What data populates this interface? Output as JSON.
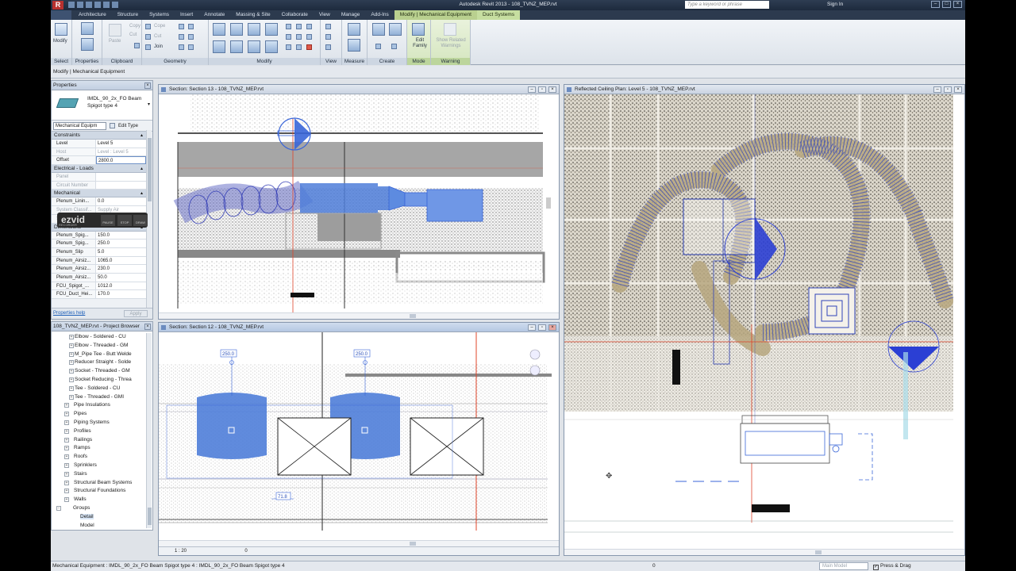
{
  "titlebar": {
    "title": "Autodesk Revit 2013   -   108_TVNZ_MEP.rvt",
    "search_placeholder": "Type a keyword or phrase",
    "sign_in": "Sign In"
  },
  "tabs": [
    {
      "label": "Architecture"
    },
    {
      "label": "Structure"
    },
    {
      "label": "Systems"
    },
    {
      "label": "Insert"
    },
    {
      "label": "Annotate"
    },
    {
      "label": "Massing & Site"
    },
    {
      "label": "Collaborate"
    },
    {
      "label": "View"
    },
    {
      "label": "Manage"
    },
    {
      "label": "Add-Ins"
    },
    {
      "label": "Modify | Mechanical Equipment"
    },
    {
      "label": "Duct Systems"
    }
  ],
  "ribbon": {
    "modify_label": "Modify",
    "paste_label": "Paste",
    "copy_label": "Copy",
    "cut_label": "Cut",
    "join_label": "Join",
    "edit_family_label": "Edit Family",
    "show_warnings_label": "Show Related Warnings",
    "panels": {
      "select": "Select",
      "properties": "Properties",
      "clipboard": "Clipboard",
      "geometry": "Geometry",
      "modify": "Modify",
      "view": "View",
      "measure": "Measure",
      "create": "Create",
      "mode": "Mode",
      "warning": "Warning"
    }
  },
  "options_bar": "Modify | Mechanical Equipment",
  "properties": {
    "title": "Properties",
    "type_name": "IMDL_90_2x_FO Beam Spigot type 4",
    "instance_filter": "Mechanical Equipm",
    "edit_type": "Edit Type",
    "groups": [
      {
        "name": "Constraints",
        "rows": [
          {
            "k": "Level",
            "v": "Level 5",
            "ro": false
          },
          {
            "k": "Host",
            "v": "Level : Level 5",
            "ro": true
          },
          {
            "k": "Offset",
            "v": "2800.0",
            "ro": false,
            "editing": true
          }
        ]
      },
      {
        "name": "Electrical - Loads",
        "rows": [
          {
            "k": "Panel",
            "v": "",
            "ro": true
          },
          {
            "k": "Circuit Number",
            "v": "",
            "ro": true
          }
        ]
      },
      {
        "name": "Mechanical",
        "rows": [
          {
            "k": "Plenum_Linin...",
            "v": "0.0",
            "ro": false
          },
          {
            "k": "System Classif...",
            "v": "Supply Air",
            "ro": true
          },
          {
            "k": "System Name",
            "v": "SA 131",
            "ro": true
          }
        ]
      },
      {
        "name": "Dimensions",
        "rows": [
          {
            "k": "Plenum_Spig...",
            "v": "150.0",
            "ro": false
          },
          {
            "k": "Plenum_Spig...",
            "v": "250.0",
            "ro": false
          },
          {
            "k": "Plenum_Slip",
            "v": "5.0",
            "ro": false
          },
          {
            "k": "Plenum_Airsiz...",
            "v": "1065.0",
            "ro": false
          },
          {
            "k": "Plenum_Airsiz...",
            "v": "230.0",
            "ro": false
          },
          {
            "k": "Plenum_Airsiz...",
            "v": "50.0",
            "ro": false
          },
          {
            "k": "FCU_Spigot_...",
            "v": "1012.0",
            "ro": false
          },
          {
            "k": "FCU_Duct_Hei...",
            "v": "170.0",
            "ro": false
          }
        ]
      }
    ],
    "help": "Properties help",
    "apply": "Apply"
  },
  "browser": {
    "title": "108_TVNZ_MEP.rvt - Project Browser",
    "items": [
      {
        "label": "Elbow - Soldered - CU",
        "level": "l2",
        "tw": "+"
      },
      {
        "label": "Elbow - Threaded - GM",
        "level": "l2",
        "tw": "+"
      },
      {
        "label": "M_Pipe Tee - Butt Welde",
        "level": "l2",
        "tw": "+"
      },
      {
        "label": "Reducer Straight - Solde",
        "level": "l2",
        "tw": "+"
      },
      {
        "label": "Socket - Threaded - GM",
        "level": "l2",
        "tw": "+"
      },
      {
        "label": "Socket Reducing - Threa",
        "level": "l2",
        "tw": "+"
      },
      {
        "label": "Tee - Soldered - CU",
        "level": "l2",
        "tw": "+"
      },
      {
        "label": "Tee - Threaded - GMI",
        "level": "l2",
        "tw": "+"
      },
      {
        "label": "Pipe Insulations",
        "level": "l1",
        "tw": "+"
      },
      {
        "label": "Pipes",
        "level": "l1",
        "tw": "+"
      },
      {
        "label": "Piping Systems",
        "level": "l1",
        "tw": "+"
      },
      {
        "label": "Profiles",
        "level": "l1",
        "tw": "+"
      },
      {
        "label": "Railings",
        "level": "l1",
        "tw": "+"
      },
      {
        "label": "Ramps",
        "level": "l1",
        "tw": "+"
      },
      {
        "label": "Roofs",
        "level": "l1",
        "tw": "+"
      },
      {
        "label": "Sprinklers",
        "level": "l1",
        "tw": "+"
      },
      {
        "label": "Stairs",
        "level": "l1",
        "tw": "+"
      },
      {
        "label": "Structural Beam Systems",
        "level": "l1",
        "tw": "+"
      },
      {
        "label": "Structural Foundations",
        "level": "l1",
        "tw": "+"
      },
      {
        "label": "Walls",
        "level": "l1",
        "tw": "+"
      },
      {
        "label": "Groups",
        "level": "l0",
        "tw": "−"
      },
      {
        "label": "Detail",
        "level": "l3",
        "tw": ""
      },
      {
        "label": "Model",
        "level": "l3",
        "tw": ""
      }
    ]
  },
  "ezvid": {
    "logo": "ezvid",
    "sub": "RECORDER",
    "b1": "PAUSE",
    "b2": "STOP",
    "b3": "DRAW"
  },
  "views": {
    "section13": {
      "title": "Section: Section 13 - 108_TVNZ_MEP.rvt"
    },
    "section12": {
      "title": "Section: Section 12 - 108_TVNZ_MEP.rvt",
      "scale": "1 : 20",
      "zero": "0",
      "dim1": "250.0",
      "dim2": "250.0",
      "dim3": "71.8"
    },
    "rcp": {
      "title": "Reflected Ceiling Plan: Level 5 - 108_TVNZ_MEP.rvt"
    }
  },
  "statusbar": {
    "message": "Mechanical Equipment : IMDL_90_2x_FO Beam Spigot type 4 : IMDL_90_2x_FO Beam Spigot type 4",
    "zero": "0",
    "model": "Main Model",
    "press_drag": "Press & Drag"
  },
  "colors": {
    "accent": "#4169e1",
    "selection_blue": "#3a66d8",
    "cutline_red": "#e0442a",
    "context_tab": "#b9d08f"
  }
}
